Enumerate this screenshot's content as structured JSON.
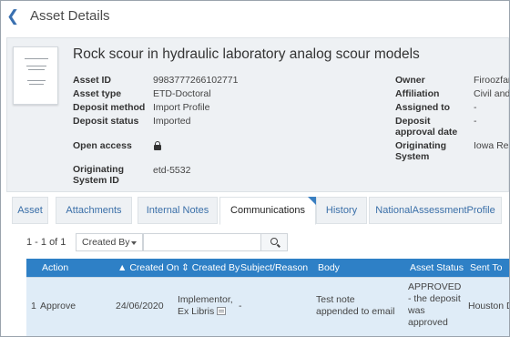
{
  "header": {
    "title": "Asset Details",
    "back_icon": "chevron-left-icon"
  },
  "asset": {
    "title": "Rock scour in hydraulic laboratory analog scour models",
    "left_fields": [
      {
        "label": "Asset ID",
        "value": "9983777266102771"
      },
      {
        "label": "Asset type",
        "value": "ETD-Doctoral"
      },
      {
        "label": "Deposit method",
        "value": "Import Profile"
      },
      {
        "label": "Deposit status",
        "value": "Imported"
      },
      {
        "label": "Open access",
        "value": ""
      },
      {
        "label": "Originating System ID",
        "value": "etd-5532"
      }
    ],
    "open_access_icon": "lock-icon",
    "right_fields": [
      {
        "label": "Owner",
        "value": "Firoozfar"
      },
      {
        "label": "Affiliation",
        "value": "Civil and"
      },
      {
        "label": "Assigned to",
        "value": "-"
      },
      {
        "label": "Deposit approval date",
        "value": "-"
      },
      {
        "label": "Originating System",
        "value": "Iowa Res"
      }
    ]
  },
  "tabs": [
    {
      "label": "Asset",
      "active": false
    },
    {
      "label": "Attachments",
      "active": false
    },
    {
      "label": "Internal Notes",
      "active": false
    },
    {
      "label": "Communications",
      "active": true
    },
    {
      "label": "History",
      "active": false
    },
    {
      "label": "NationalAssessmentProfile",
      "active": false
    }
  ],
  "list_controls": {
    "count": "1 - 1 of 1",
    "filter_label": "Created By",
    "search_placeholder": "",
    "search_icon": "search-icon"
  },
  "table": {
    "columns": [
      "Action",
      "Created On",
      "Created By",
      "Subject/Reason",
      "Body",
      "Asset Status",
      "Sent To"
    ],
    "rows": [
      {
        "index": "1",
        "action": "Approve",
        "created_on": "24/06/2020",
        "created_by": "Implementor, Ex Libris",
        "subject": "-",
        "body": "Test note appended to email",
        "status": "APPROVED - the deposit was approved",
        "sent_to": "Houston D"
      }
    ]
  },
  "colors": {
    "accent": "#2e80c6",
    "panel": "#eef1f4",
    "row_highlight": "#dfecf7",
    "link": "#3a6fa8"
  }
}
